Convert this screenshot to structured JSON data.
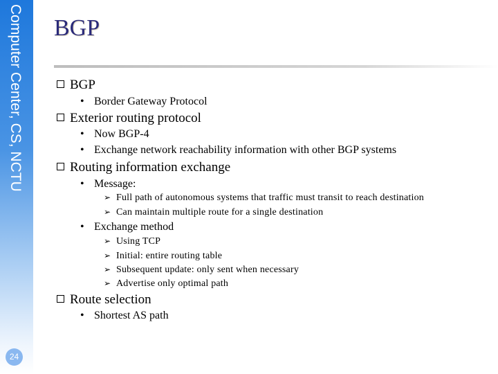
{
  "sidebar": {
    "label": "Computer Center, CS, NCTU",
    "page_number": "24",
    "colors": {
      "gradient_top": "#1e78dc",
      "badge": "#8ab8f0"
    }
  },
  "title": "BGP",
  "content": [
    {
      "text": "BGP",
      "children": [
        {
          "text": "Border Gateway Protocol"
        }
      ]
    },
    {
      "text": "Exterior routing protocol",
      "children": [
        {
          "text": "Now BGP-4"
        },
        {
          "text": "Exchange network reachability information with other BGP systems"
        }
      ]
    },
    {
      "text": "Routing information exchange",
      "children": [
        {
          "text": "Message:",
          "children": [
            {
              "text": "Full path of autonomous systems that traffic must transit to reach destination"
            },
            {
              "text": "Can maintain multiple route for a single destination"
            }
          ]
        },
        {
          "text": "Exchange method",
          "children": [
            {
              "text": "Using TCP"
            },
            {
              "text": "Initial: entire routing table"
            },
            {
              "text": "Subsequent update: only sent when necessary"
            },
            {
              "text": "Advertise only optimal path"
            }
          ]
        }
      ]
    },
    {
      "text": "Route selection",
      "children": [
        {
          "text": "Shortest AS path"
        }
      ]
    }
  ]
}
